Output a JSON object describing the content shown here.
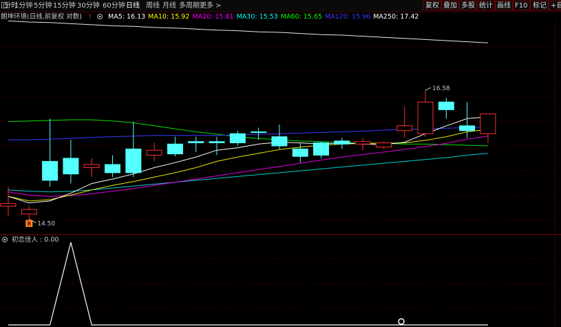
{
  "toolbar": {
    "left_items": [
      "分时",
      "1分钟",
      "5分钟",
      "15分钟",
      "30分钟",
      "60分钟",
      "日线",
      "周线",
      "月线",
      "多周期",
      "更多 >"
    ],
    "active_item": "日线",
    "right_items": [
      "复权",
      "叠加",
      "多股",
      "统计",
      "画线",
      "F10",
      "标记",
      "+自"
    ]
  },
  "legend": {
    "title": "朗坤环境(日线,前复权 对数)",
    "ma_items": [
      {
        "label": "MA5: 16.13",
        "color": "#ffffff"
      },
      {
        "label": "MA10: 15.92",
        "color": "#ffff00"
      },
      {
        "label": "MA20: 15.81",
        "color": "#ff00ff"
      },
      {
        "label": "MA30: 15.53",
        "color": "#00ffff"
      },
      {
        "label": "MA60: 15.65",
        "color": "#00ff00"
      },
      {
        "label": "MA120: 15.96",
        "color": "#3a3aff"
      },
      {
        "label": "MA250: 17.42",
        "color": "#ffffff"
      }
    ]
  },
  "indicator": {
    "label": "初恋佳人 : 0.00",
    "color": "#c8c8c8"
  },
  "annotations": {
    "high_label": "16.58",
    "low_label": "14.50",
    "buy_marker": "B"
  },
  "chart_data": {
    "type": "candlestick",
    "title": "",
    "ylim": [
      14.3,
      17.8
    ],
    "grid": true,
    "candles": [
      {
        "o": 14.7,
        "h": 15.0,
        "l": 14.55,
        "c": 14.74
      },
      {
        "o": 14.58,
        "h": 14.7,
        "l": 14.5,
        "c": 14.65
      },
      {
        "o": 15.4,
        "h": 16.1,
        "l": 15.0,
        "c": 15.1
      },
      {
        "o": 15.45,
        "h": 15.75,
        "l": 15.05,
        "c": 15.2
      },
      {
        "o": 15.3,
        "h": 15.45,
        "l": 15.15,
        "c": 15.35
      },
      {
        "o": 15.35,
        "h": 15.5,
        "l": 15.15,
        "c": 15.22
      },
      {
        "o": 15.6,
        "h": 16.05,
        "l": 15.15,
        "c": 15.22
      },
      {
        "o": 15.5,
        "h": 15.7,
        "l": 15.4,
        "c": 15.58
      },
      {
        "o": 15.68,
        "h": 15.8,
        "l": 15.48,
        "c": 15.52
      },
      {
        "o": 15.72,
        "h": 15.8,
        "l": 15.55,
        "c": 15.7
      },
      {
        "o": 15.72,
        "h": 15.8,
        "l": 15.5,
        "c": 15.7
      },
      {
        "o": 15.85,
        "h": 15.9,
        "l": 15.65,
        "c": 15.7
      },
      {
        "o": 15.88,
        "h": 15.95,
        "l": 15.75,
        "c": 15.87
      },
      {
        "o": 15.8,
        "h": 16.0,
        "l": 15.6,
        "c": 15.65
      },
      {
        "o": 15.6,
        "h": 15.7,
        "l": 15.38,
        "c": 15.48
      },
      {
        "o": 15.7,
        "h": 15.72,
        "l": 15.45,
        "c": 15.5
      },
      {
        "o": 15.73,
        "h": 15.78,
        "l": 15.6,
        "c": 15.68
      },
      {
        "o": 15.68,
        "h": 15.78,
        "l": 15.58,
        "c": 15.72
      },
      {
        "o": 15.63,
        "h": 15.72,
        "l": 15.6,
        "c": 15.7
      },
      {
        "o": 15.9,
        "h": 16.3,
        "l": 15.78,
        "c": 15.98
      },
      {
        "o": 15.85,
        "h": 16.58,
        "l": 15.8,
        "c": 16.38
      },
      {
        "o": 16.38,
        "h": 16.45,
        "l": 16.1,
        "c": 16.25
      },
      {
        "o": 15.98,
        "h": 16.38,
        "l": 15.78,
        "c": 15.9
      },
      {
        "o": 15.85,
        "h": 16.18,
        "l": 15.7,
        "c": 16.18
      }
    ],
    "ma5": [
      14.85,
      14.75,
      14.78,
      14.9,
      15.05,
      15.12,
      15.2,
      15.3,
      15.38,
      15.47,
      15.58,
      15.62,
      15.68,
      15.71,
      15.7,
      15.68,
      15.7,
      15.68,
      15.67,
      15.71,
      15.85,
      15.98,
      16.1,
      16.13
    ],
    "ma10": [
      14.85,
      14.78,
      14.8,
      14.87,
      14.95,
      15.02,
      15.08,
      15.15,
      15.22,
      15.3,
      15.4,
      15.47,
      15.53,
      15.59,
      15.63,
      15.66,
      15.68,
      15.69,
      15.69,
      15.7,
      15.74,
      15.8,
      15.88,
      15.92
    ],
    "ma20": [
      14.92,
      14.87,
      14.85,
      14.86,
      14.89,
      14.93,
      14.97,
      15.02,
      15.07,
      15.12,
      15.17,
      15.22,
      15.27,
      15.32,
      15.37,
      15.42,
      15.47,
      15.51,
      15.55,
      15.59,
      15.64,
      15.69,
      15.76,
      15.81
    ],
    "ma30": [
      14.95,
      14.93,
      14.92,
      14.93,
      14.95,
      14.98,
      15.01,
      15.04,
      15.07,
      15.1,
      15.13,
      15.16,
      15.19,
      15.22,
      15.25,
      15.28,
      15.31,
      15.34,
      15.37,
      15.4,
      15.43,
      15.46,
      15.5,
      15.53
    ],
    "ma60": [
      16.05,
      16.06,
      16.07,
      16.08,
      16.08,
      16.06,
      16.03,
      15.98,
      15.93,
      15.88,
      15.84,
      15.8,
      15.77,
      15.75,
      15.73,
      15.72,
      15.71,
      15.7,
      15.69,
      15.68,
      15.68,
      15.67,
      15.66,
      15.65
    ],
    "ma120": [
      15.75,
      15.75,
      15.76,
      15.77,
      15.79,
      15.8,
      15.81,
      15.82,
      15.82,
      15.82,
      15.82,
      15.83,
      15.84,
      15.85,
      15.86,
      15.87,
      15.88,
      15.89,
      15.91,
      15.92,
      15.93,
      15.94,
      15.95,
      15.96
    ],
    "ma250": [
      17.82,
      17.8,
      17.79,
      17.77,
      17.75,
      17.73,
      17.72,
      17.7,
      17.69,
      17.67,
      17.65,
      17.64,
      17.62,
      17.61,
      17.59,
      17.57,
      17.56,
      17.54,
      17.52,
      17.5,
      17.48,
      17.46,
      17.44,
      17.42
    ],
    "indicator_values": [
      0,
      0,
      0,
      1,
      0,
      0,
      0,
      0,
      0,
      0,
      0,
      0,
      0,
      0,
      0,
      0,
      0,
      0,
      0,
      0,
      0,
      0,
      0,
      0
    ]
  }
}
